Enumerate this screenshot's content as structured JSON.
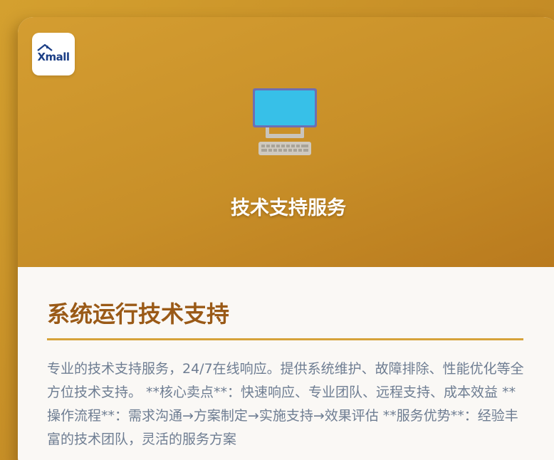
{
  "logo": {
    "brand": "Xmall",
    "icon": "house-roof-icon"
  },
  "hero": {
    "icon": "desktop-computer-icon",
    "title": "技术支持服务",
    "colors": {
      "start": "#d49d31",
      "end": "#b97a1e",
      "screen": "#37c0e8"
    }
  },
  "content": {
    "title": "系统运行技术支持",
    "description": "专业的技术支持服务，24/7在线响应。提供系统维护、故障排除、性能优化等全方位技术支持。 **核心卖点**：快速响应、专业团队、远程支持、成本效益 **操作流程**：需求沟通→方案制定→实施支持→效果评估 **服务优势**：经验丰富的技术团队，灵活的服务方案",
    "colors": {
      "title": "#9a5a17",
      "divider": "#d6a33a",
      "text": "#6e7d92"
    }
  }
}
